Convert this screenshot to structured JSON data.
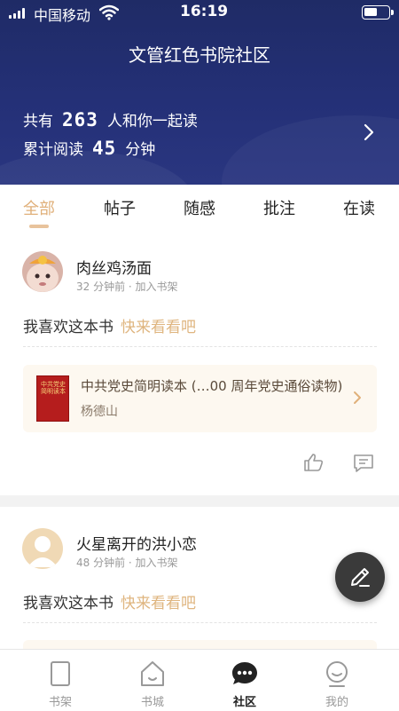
{
  "status_bar": {
    "carrier": "中国移动",
    "time": "16:19"
  },
  "header": {
    "title": "文管红色书院社区",
    "stat_readers": {
      "prefix": "共有",
      "value": "263",
      "suffix": "人和你一起读"
    },
    "stat_minutes": {
      "prefix": "累计阅读",
      "value": "45",
      "suffix": "分钟"
    }
  },
  "tabs": [
    {
      "label": "全部",
      "active": true
    },
    {
      "label": "帖子"
    },
    {
      "label": "随感"
    },
    {
      "label": "批注"
    },
    {
      "label": "在读"
    }
  ],
  "posts": [
    {
      "username": "肉丝鸡汤面",
      "meta": "32 分钟前 · 加入书架",
      "text": "我喜欢这本书",
      "link_text": "快来看看吧",
      "book": {
        "title": "中共党史简明读本 (…00 周年党史通俗读物)",
        "author": "杨德山",
        "cover_text": "中共党史简明读本"
      }
    },
    {
      "username": "火星离开的洪小恋",
      "meta": "48 分钟前 · 加入书架",
      "text": "我喜欢这本书",
      "link_text": "快来看看吧"
    }
  ],
  "bottom_nav": [
    {
      "label": "书架",
      "icon": "bookshelf-icon"
    },
    {
      "label": "书城",
      "icon": "home-icon"
    },
    {
      "label": "社区",
      "icon": "community-icon",
      "active": true
    },
    {
      "label": "我的",
      "icon": "profile-icon"
    }
  ],
  "colors": {
    "header_bg": "#243077",
    "accent": "#dfb57f",
    "fab_bg": "#3a3a3a"
  }
}
